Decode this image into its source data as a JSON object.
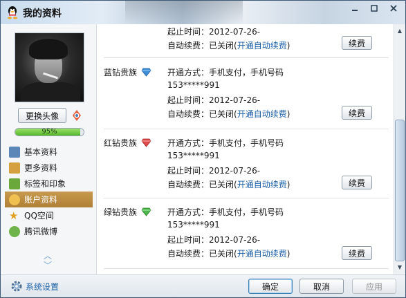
{
  "window": {
    "title": "我的资料",
    "controls": [
      "minimize-icon",
      "maximize-icon",
      "close-icon"
    ]
  },
  "sidebar": {
    "change_avatar_label": "更换头像",
    "progress": {
      "value_text": "95%",
      "fraction": 0.95
    },
    "items": [
      {
        "label": "基本资料",
        "icon": "profile-card-icon",
        "active": false
      },
      {
        "label": "更多资料",
        "icon": "more-info-icon",
        "active": false
      },
      {
        "label": "标签和印象",
        "icon": "tag-icon",
        "active": false
      },
      {
        "label": "账户资料",
        "icon": "account-icon",
        "active": true
      },
      {
        "label": "QQ空间",
        "icon": "qzone-star-icon",
        "active": false
      },
      {
        "label": "腾讯微博",
        "icon": "weibo-icon",
        "active": false
      }
    ]
  },
  "content": {
    "top_partial": {
      "period_label": "起止时间：2012-07-26-",
      "auto_renew_prefix": "自动续费：已关闭(",
      "auto_renew_link": "开通自动续费",
      "auto_renew_suffix": ")",
      "renew_label": "续费"
    },
    "vip_rows": [
      {
        "name": "蓝钻贵族",
        "icon": "blue-diamond-icon",
        "open_method": "开通方式：手机支付，手机号码",
        "phone": "153*****991",
        "period": "起止时间：2012-07-26-",
        "auto_renew_prefix": "自动续费：已关闭(",
        "auto_renew_link": "开通自动续费",
        "auto_renew_suffix": ")",
        "renew_label": "续费"
      },
      {
        "name": "红钻贵族",
        "icon": "red-diamond-icon",
        "open_method": "开通方式：手机支付，手机号码",
        "phone": "153*****991",
        "period": "起止时间：2012-07-26-",
        "auto_renew_prefix": "自动续费：已关闭(",
        "auto_renew_link": "开通自动续费",
        "auto_renew_suffix": ")",
        "renew_label": "续费"
      },
      {
        "name": "绿钻贵族",
        "icon": "green-diamond-icon",
        "open_method": "开通方式：手机支付，手机号码",
        "phone": "153*****991",
        "period": "起止时间：2012-07-26-",
        "auto_renew_prefix": "自动续费：已关闭(",
        "auto_renew_link": "开通自动续费",
        "auto_renew_suffix": ")",
        "renew_label": "续费"
      }
    ]
  },
  "footer": {
    "settings_label": "系统设置",
    "ok_label": "确定",
    "cancel_label": "取消",
    "apply_label": "应用"
  },
  "colors": {
    "active_nav": "#b8873c",
    "link": "#1e62a8",
    "progress": "#6cc73a"
  }
}
